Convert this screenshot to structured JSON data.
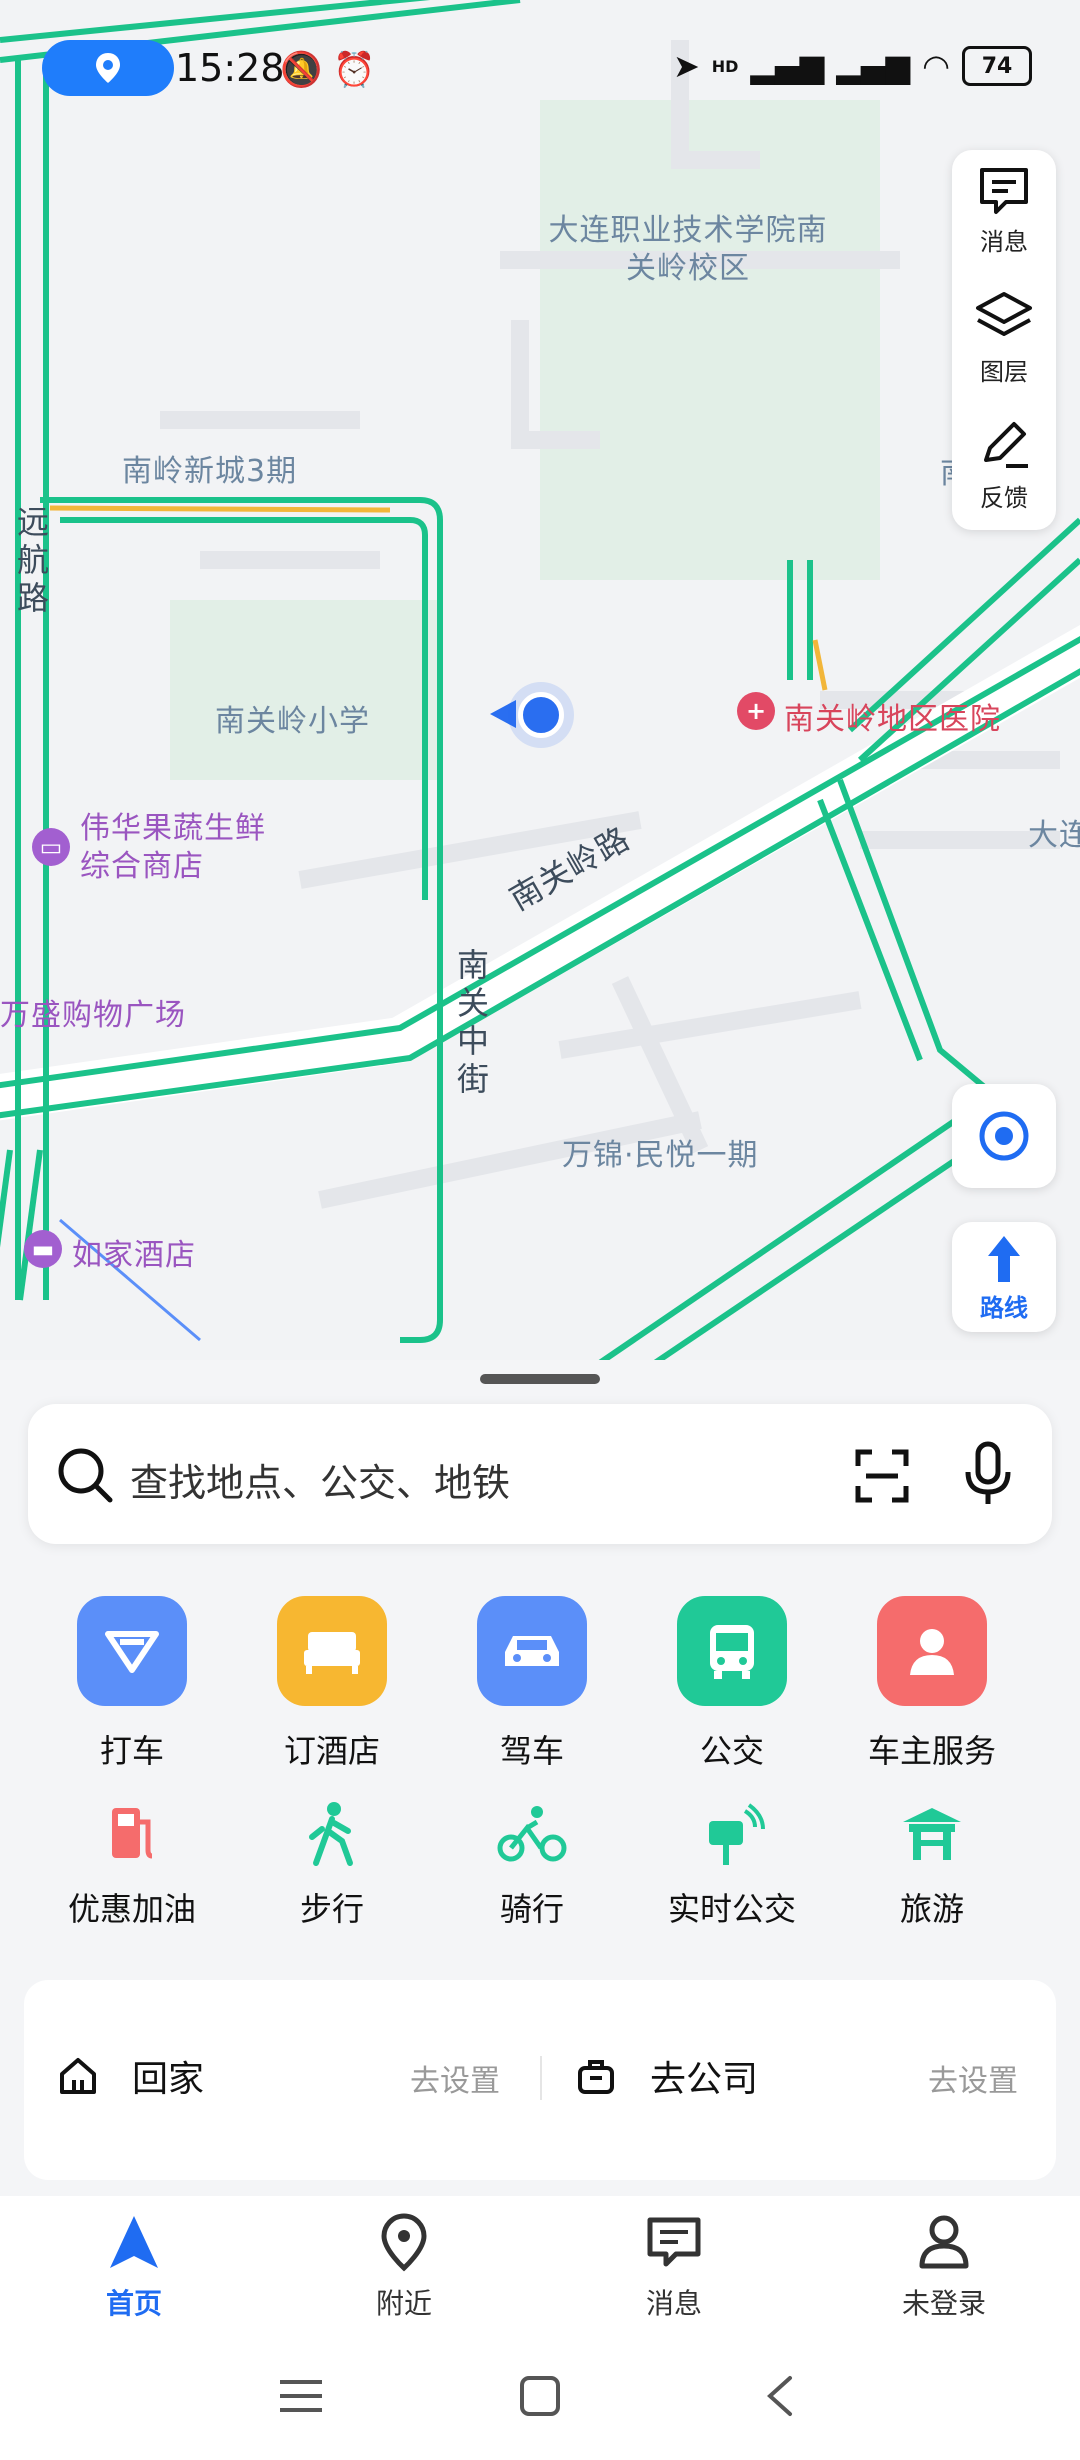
{
  "status_bar": {
    "time": "15:28",
    "battery": "74",
    "network": "HD"
  },
  "map": {
    "labels": {
      "college": "大连职业技术学院南关岭校区",
      "community1": "南岭新城3期",
      "road_yuanhang": "远航路",
      "school": "南关岭小学",
      "hospital": "南关岭地区医院",
      "store": "伟华果蔬生鲜综合商店",
      "road_nanguanling": "南关岭路",
      "street_zhongjie": "南关中街",
      "mall": "万盛购物广场",
      "community2": "万锦·民悦一期",
      "hotel": "如家酒店",
      "right_edge": "大连",
      "right_top": "南 家"
    }
  },
  "tools": {
    "message": "消息",
    "layers": "图层",
    "feedback": "反馈",
    "route": "路线"
  },
  "search": {
    "placeholder": "查找地点、公交、地铁"
  },
  "services_row1": [
    {
      "label": "打车",
      "color": "#5b8ff9"
    },
    {
      "label": "订酒店",
      "color": "#f7b731"
    },
    {
      "label": "驾车",
      "color": "#5b8ff9"
    },
    {
      "label": "公交",
      "color": "#20c997"
    },
    {
      "label": "车主服务",
      "color": "#f56c6c"
    }
  ],
  "services_row2": [
    {
      "label": "优惠加油"
    },
    {
      "label": "步行"
    },
    {
      "label": "骑行"
    },
    {
      "label": "实时公交"
    },
    {
      "label": "旅游"
    }
  ],
  "shortcuts": {
    "home": "回家",
    "home_action": "去设置",
    "work": "去公司",
    "work_action": "去设置"
  },
  "tabs": [
    {
      "label": "首页",
      "active": true
    },
    {
      "label": "附近"
    },
    {
      "label": "消息"
    },
    {
      "label": "未登录"
    }
  ],
  "colors": {
    "accent": "#1f6cf2",
    "route_green": "#1bc28a"
  }
}
